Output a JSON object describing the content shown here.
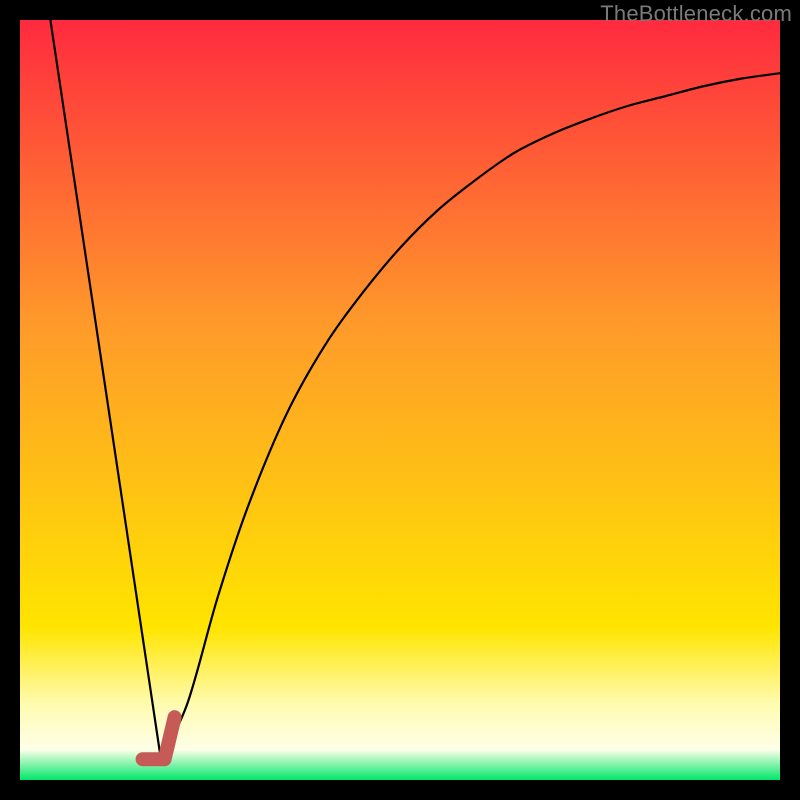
{
  "credit": "TheBottleneck.com",
  "colors": {
    "red": "#ff2a3f",
    "yellow": "#ffe500",
    "pale_yellow": "#fffbb0",
    "white_band": "#feffe8",
    "green": "#00e76a",
    "curve": "#000000",
    "marker": "#c65a57"
  },
  "chart_data": {
    "type": "line",
    "title": "",
    "xlabel": "",
    "ylabel": "",
    "xlim": [
      0,
      100
    ],
    "ylim": [
      0,
      100
    ],
    "series": [
      {
        "name": "left-descent",
        "x": [
          4,
          18.5
        ],
        "values": [
          100,
          3
        ]
      },
      {
        "name": "right-curve",
        "x": [
          18.5,
          22,
          26,
          30,
          35,
          40,
          45,
          50,
          55,
          60,
          65,
          70,
          75,
          80,
          85,
          90,
          95,
          100
        ],
        "values": [
          3,
          10,
          24,
          36,
          48,
          57,
          64,
          70,
          75,
          79,
          82.5,
          85,
          87,
          88.7,
          90,
          91.3,
          92.3,
          93
        ]
      }
    ],
    "marker": {
      "x": 18.5,
      "y": 3,
      "style": "J-hook",
      "color": "#c65a57"
    },
    "gradient_bands_y": [
      {
        "at": 0,
        "color": "#00e76a"
      },
      {
        "at": 4,
        "color": "#feffe8"
      },
      {
        "at": 10,
        "color": "#fffbb0"
      },
      {
        "at": 20,
        "color": "#ffe500"
      },
      {
        "at": 60,
        "color": "#ff9a2a"
      },
      {
        "at": 100,
        "color": "#ff2a3f"
      }
    ]
  }
}
